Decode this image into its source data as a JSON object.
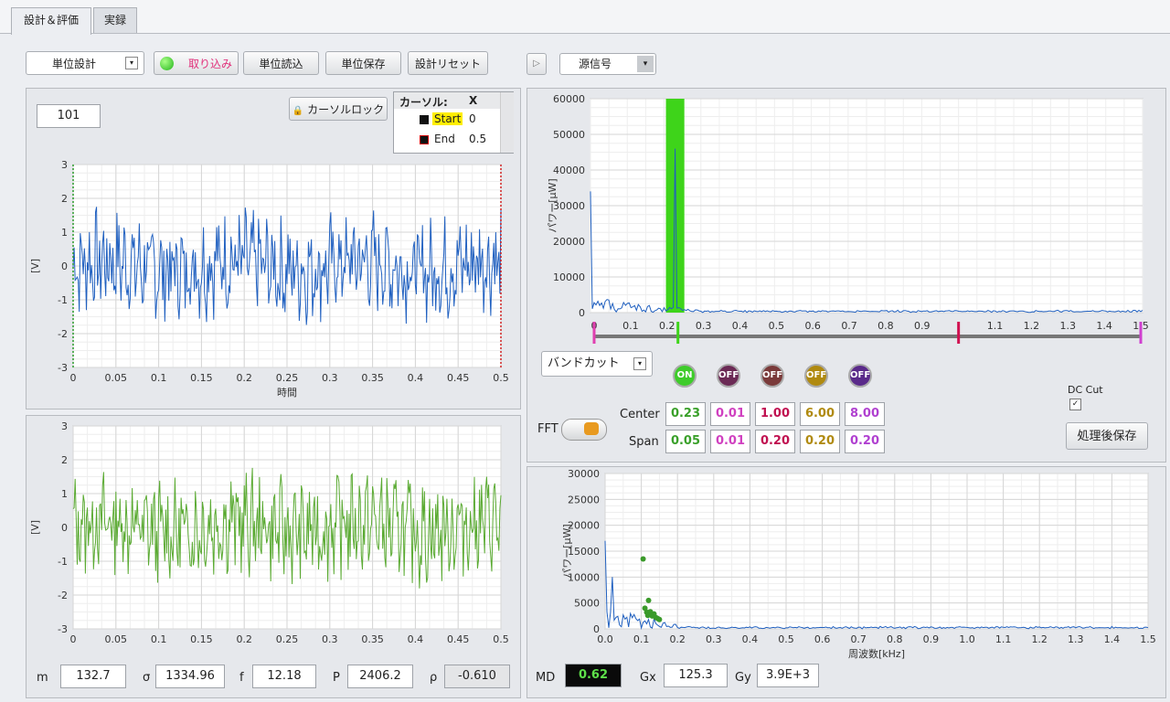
{
  "tabs": [
    {
      "label": "設計＆評価"
    },
    {
      "label": "実録"
    }
  ],
  "toolbar": {
    "mode_select": "単位設計",
    "capture": "取り込み",
    "load": "単位読込",
    "save": "単位保存",
    "reset": "設計リセット",
    "signal_select": "源信号"
  },
  "time_panel": {
    "count": "101",
    "cursor_lock": "カーソルロック",
    "cursor_table": {
      "header_name": "カーソル:",
      "header_x": "X",
      "rows": [
        {
          "name": "Start",
          "x": "0"
        },
        {
          "name": "End",
          "x": "0.5"
        }
      ]
    }
  },
  "stats": {
    "m_label": "m",
    "m": "132.7",
    "sigma_label": "σ",
    "sigma": "1334.96",
    "f_label": "f",
    "f": "12.18",
    "p_label": "P",
    "p": "2406.2",
    "rho_label": "ρ",
    "rho": "-0.610"
  },
  "filter": {
    "type": "バンドカット",
    "leds": [
      {
        "label": "ON",
        "color": "#3ecc2a"
      },
      {
        "label": "OFF",
        "color": "#6b2a55"
      },
      {
        "label": "OFF",
        "color": "#7a3a3a"
      },
      {
        "label": "OFF",
        "color": "#b08a10"
      },
      {
        "label": "OFF",
        "color": "#5a2a8a"
      }
    ],
    "center_label": "Center",
    "span_label": "Span",
    "center": [
      {
        "v": "0.23",
        "color": "#3aa02a"
      },
      {
        "v": "0.01",
        "color": "#d040c0"
      },
      {
        "v": "1.00",
        "color": "#c01050"
      },
      {
        "v": "6.00",
        "color": "#b08a10"
      },
      {
        "v": "8.00",
        "color": "#b040d0"
      }
    ],
    "span": [
      {
        "v": "0.05",
        "color": "#3aa02a"
      },
      {
        "v": "0.01",
        "color": "#d040c0"
      },
      {
        "v": "0.20",
        "color": "#c01050"
      },
      {
        "v": "0.20",
        "color": "#b08a10"
      },
      {
        "v": "0.20",
        "color": "#b040d0"
      }
    ],
    "fft_label": "FFT",
    "dc_cut_label": "DC Cut",
    "save_processed": "処理後保存",
    "slider_markers": [
      0,
      0.23,
      1.0,
      1.5
    ],
    "slider_ticks": [
      "0",
      "0.1",
      "0.2",
      "0.3",
      "0.4",
      "0.5",
      "0.6",
      "0.7",
      "0.8",
      "0.9",
      "1.1",
      "1.2",
      "1.3",
      "1.4",
      "1.5"
    ]
  },
  "bottom_right": {
    "md_label": "MD",
    "md": "0.62",
    "gx_label": "Gx",
    "gx": "125.3",
    "gy_label": "Gy",
    "gy": "3.9E+3"
  },
  "chart_data": [
    {
      "type": "line",
      "ylabel": "[V]",
      "xlabel": "時間",
      "xlim": [
        0,
        0.5
      ],
      "ylim": [
        -3,
        3
      ],
      "xticks": [
        "0",
        "0.05",
        "0.1",
        "0.15",
        "0.2",
        "0.25",
        "0.3",
        "0.35",
        "0.4",
        "0.45",
        "0.5"
      ],
      "yticks": [
        "3",
        "2",
        "1",
        "0",
        "-1",
        "-2",
        "-3"
      ],
      "series": [
        {
          "color": "#2060c0",
          "amplitude": 1.2,
          "seed": 7
        }
      ]
    },
    {
      "type": "line",
      "ylabel": "[V]",
      "xlabel": "",
      "xlim": [
        0,
        0.5
      ],
      "ylim": [
        -3,
        3
      ],
      "xticks": [
        "0",
        "0.05",
        "0.1",
        "0.15",
        "0.2",
        "0.25",
        "0.3",
        "0.35",
        "0.4",
        "0.45",
        "0.5"
      ],
      "yticks": [
        "3",
        "2",
        "1",
        "0",
        "-1",
        "-2",
        "-3"
      ],
      "series": [
        {
          "color": "#5aaa32",
          "amplitude": 1.2,
          "seed": 13
        }
      ]
    },
    {
      "type": "line",
      "ylabel": "パワー[μW]",
      "xlim": [
        0,
        1.5
      ],
      "ylim": [
        0,
        60000
      ],
      "yticks": [
        "60000",
        "50000",
        "40000",
        "30000",
        "20000",
        "10000",
        "0"
      ],
      "band": {
        "from": 0.205,
        "to": 0.255,
        "color": "#3ed41a"
      },
      "peaks": [
        {
          "x": 0.0,
          "y": 34000
        },
        {
          "x": 0.23,
          "y": 46000
        }
      ],
      "series": [
        {
          "color": "#2060c0"
        }
      ]
    },
    {
      "type": "scatter",
      "ylabel": "パワー[μW]",
      "xlabel": "周波数[kHz]",
      "xlim": [
        0,
        1.5
      ],
      "ylim": [
        0,
        30000
      ],
      "xticks": [
        "0.0",
        "0.1",
        "0.2",
        "0.3",
        "0.4",
        "0.5",
        "0.6",
        "0.7",
        "0.8",
        "0.9",
        "1.0",
        "1.1",
        "1.2",
        "1.3",
        "1.4",
        "1.5"
      ],
      "yticks": [
        "30000",
        "25000",
        "20000",
        "15000",
        "10000",
        "5000",
        "0"
      ],
      "points": [
        {
          "x": 0.105,
          "y": 13500
        },
        {
          "x": 0.12,
          "y": 5500
        },
        {
          "x": 0.11,
          "y": 4000
        },
        {
          "x": 0.115,
          "y": 3200
        },
        {
          "x": 0.12,
          "y": 2800
        },
        {
          "x": 0.125,
          "y": 3300
        },
        {
          "x": 0.13,
          "y": 2500
        },
        {
          "x": 0.135,
          "y": 2900
        },
        {
          "x": 0.14,
          "y": 2200
        },
        {
          "x": 0.145,
          "y": 2000
        },
        {
          "x": 0.15,
          "y": 1800
        },
        {
          "x": 0.118,
          "y": 2600
        }
      ],
      "series": [
        {
          "color": "#2060c0"
        }
      ],
      "point_color": "#3a9a2a"
    }
  ]
}
